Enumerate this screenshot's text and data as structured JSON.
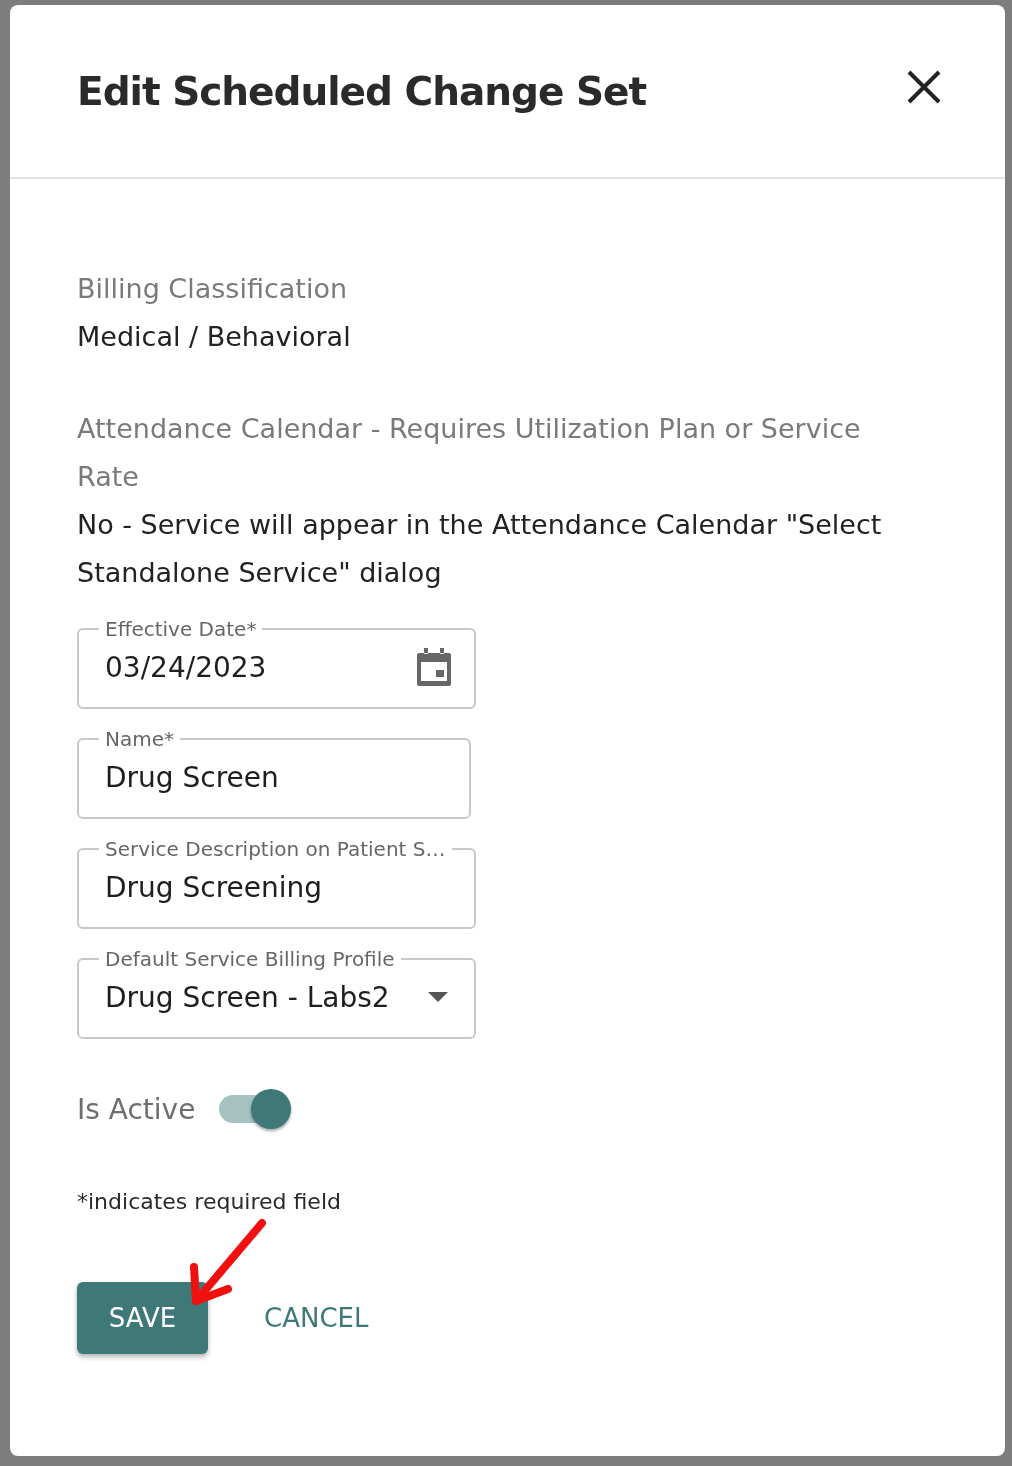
{
  "dialog": {
    "title": "Edit Scheduled Change Set"
  },
  "info": [
    {
      "label": "Billing Classification",
      "value": "Medical / Behavioral"
    },
    {
      "label": "Attendance Calendar - Requires Utilization Plan or Service Rate",
      "value": "No - Service will appear in the Attendance Calendar \"Select Standalone Service\" dialog"
    }
  ],
  "fields": [
    {
      "kind": "date",
      "label": "Effective Date*",
      "value": "03/24/2023"
    },
    {
      "kind": "text",
      "label": "Name*",
      "value": "Drug Screen"
    },
    {
      "kind": "text",
      "label": "Service Description on Patient S…",
      "value": "Drug Screening"
    },
    {
      "kind": "select",
      "label": "Default Service Billing Profile",
      "value": "Drug Screen - Labs2"
    }
  ],
  "toggle": {
    "label": "Is Active",
    "on": true
  },
  "note": "*indicates required field",
  "buttons": [
    {
      "kind": "primary",
      "label": "SAVE"
    },
    {
      "kind": "text",
      "label": "CANCEL"
    }
  ]
}
